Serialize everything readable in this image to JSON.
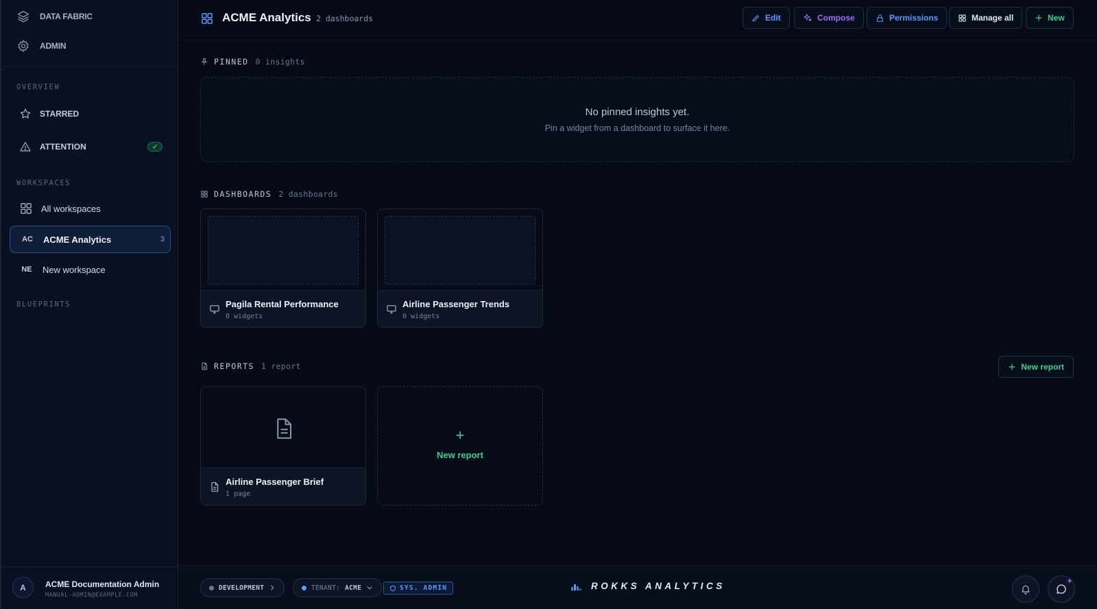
{
  "sidebar": {
    "top": [
      {
        "label": "DATA FABRIC",
        "icon": "layers-icon"
      },
      {
        "label": "ADMIN",
        "icon": "gear-icon"
      }
    ],
    "sections": {
      "overview": "OVERVIEW",
      "workspaces": "WORKSPACES",
      "blueprints": "BLUEPRINTS"
    },
    "overview_items": [
      {
        "label": "STARRED",
        "icon": "star-icon"
      },
      {
        "label": "ATTENTION",
        "icon": "warning-icon",
        "badge": "✓"
      }
    ],
    "workspace_items": [
      {
        "label": "All workspaces",
        "icon": "grid-icon"
      },
      {
        "label": "ACME Analytics",
        "abbr": "AC",
        "count": "3",
        "active": true
      },
      {
        "label": "New workspace",
        "abbr": "NE"
      }
    ],
    "user": {
      "initial": "A",
      "name": "ACME Documentation Admin",
      "email": "MANUAL-ADMIN@EXAMPLE.COM"
    }
  },
  "header": {
    "title": "ACME Analytics",
    "subtitle": "2 dashboards",
    "buttons": {
      "edit": "Edit",
      "compose": "Compose",
      "permissions": "Permissions",
      "manage_all": "Manage all",
      "new": "New"
    }
  },
  "pinned": {
    "heading": "PINNED",
    "count": "0 insights",
    "empty_title": "No pinned insights yet.",
    "empty_desc": "Pin a widget from a dashboard to surface it here."
  },
  "dashboards": {
    "heading": "DASHBOARDS",
    "count": "2 dashboards",
    "items": [
      {
        "name": "Pagila Rental Performance",
        "meta": "0 widgets"
      },
      {
        "name": "Airline Passenger Trends",
        "meta": "0 widgets"
      }
    ]
  },
  "reports": {
    "heading": "REPORTS",
    "count": "1 report",
    "new_button": "New report",
    "items": [
      {
        "name": "Airline Passenger Brief",
        "meta": "1 page"
      }
    ],
    "new_card_label": "New report",
    "new_card_plus": "+"
  },
  "statusbar": {
    "env": "DEVELOPMENT",
    "tenant_label": "TENANT:",
    "tenant_value": "ACME",
    "role": "SYS. ADMIN",
    "brand": "ROKKS ANALYTICS"
  },
  "colors": {
    "accent_blue": "#5c9bff",
    "accent_green": "#3ecf8e",
    "accent_purple": "#a36bff",
    "background": "#050a16"
  }
}
